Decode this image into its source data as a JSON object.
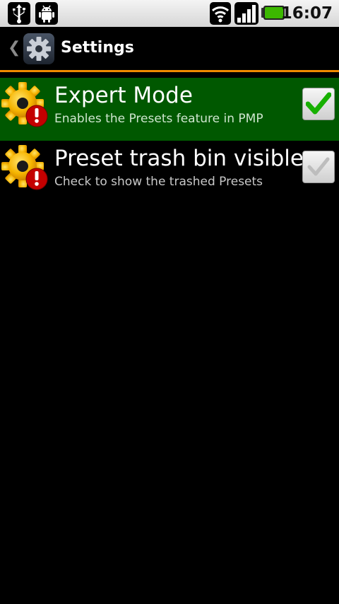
{
  "status_bar": {
    "time": "16:07",
    "icons": [
      "usb-icon",
      "android-debug-icon",
      "wifi-icon",
      "signal-icon",
      "battery-icon"
    ],
    "battery_color": "#3cb800"
  },
  "action_bar": {
    "title": "Settings",
    "back_glyph": "❮",
    "app_icon": "gear-icon"
  },
  "accent_color": "#f08a00",
  "preferences": [
    {
      "title": "Expert Mode",
      "summary": "Enables the Presets feature in PMP",
      "checked": true,
      "highlighted": true,
      "icon": "gear-warning-icon"
    },
    {
      "title": "Preset trash bin visible",
      "summary": "Check to show the trashed Presets",
      "checked": false,
      "highlighted": false,
      "icon": "gear-warning-icon"
    }
  ]
}
